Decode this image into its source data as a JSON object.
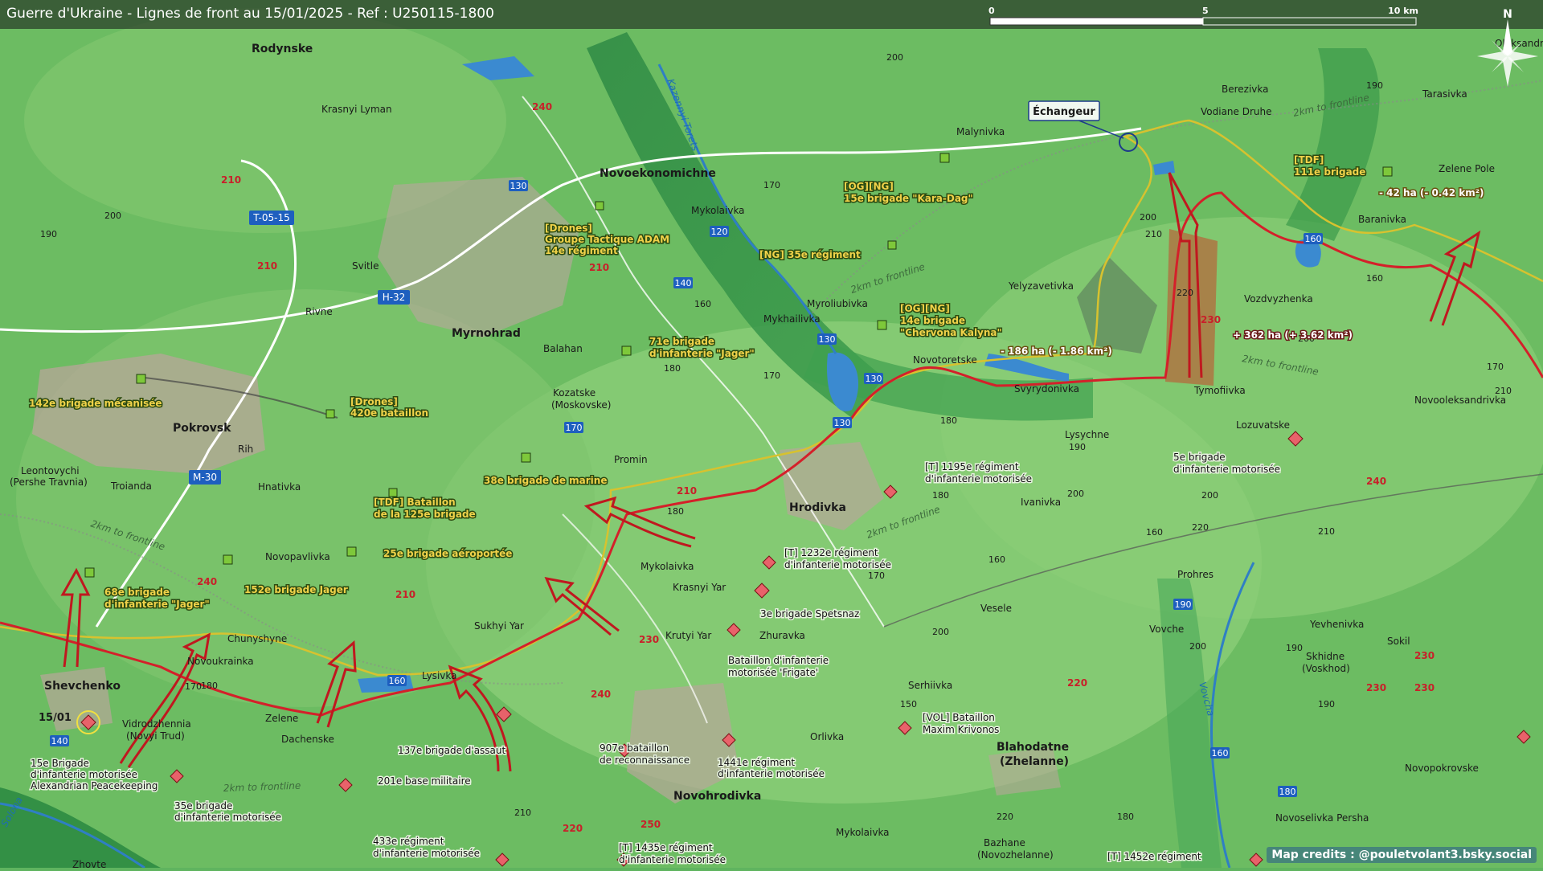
{
  "title": "Guerre d'Ukraine - Lignes de front au 15/01/2025 - Ref : U250115-1800",
  "scale": {
    "ticks": [
      "0",
      "5",
      "10 km"
    ]
  },
  "north": "N",
  "credits": "Map credits : @pouletvolant3.bsky.social",
  "date_marker": "15/01",
  "exchange": "Échangeur",
  "towns": {
    "pokrovsk": "Pokrovsk",
    "myrnohrad": "Myrnohrad",
    "novoekonomichne": "Novoekonomichne",
    "shevchenko": "Shevchenko",
    "hrodivka": "Hrodivka",
    "novohrodivka": "Novohrodivka",
    "blahodatne": "Blahodatne",
    "blahodatne_alt": "(Zhelanne)",
    "rodynske": "Rodynske"
  },
  "villages": {
    "krasnyi_lyman": "Krasnyi Lyman",
    "svitle": "Svitle",
    "rivne": "Rivne",
    "rih": "Rih",
    "leontovychi": "Leontovychi",
    "leontovychi_alt": "(Pershe Travnia)",
    "troianda": "Troianda",
    "hnativka": "Hnativka",
    "novopavlivka": "Novopavlivka",
    "chunyshyne": "Chunyshyne",
    "novoukrainka": "Novoukrainka",
    "vidrodzhennia": "Vidrodzhennia",
    "vidrodzhennia_alt": "(Novyi Trud)",
    "zelene": "Zelene",
    "dachenske": "Dachenske",
    "lysivka": "Lysivka",
    "sukhyi_yar": "Sukhyi Yar",
    "zhovte": "Zhovte",
    "balahan": "Balahan",
    "kozatske": "Kozatske",
    "kozatske_alt": "(Moskovske)",
    "promin": "Promin",
    "mykolaivka_n": "Mykolaivka",
    "mykolaivka_s": "Mykolaivka",
    "mykolaivka_se": "Mykolaivka",
    "krasnyi_yar": "Krasnyi Yar",
    "krutyi_yar": "Krutyi Yar",
    "zhuravka": "Zhuravka",
    "myroliubivka": "Myroliubivka",
    "mykhailivka": "Mykhailivka",
    "novotoretske": "Novotoretske",
    "malynivka": "Malynivka",
    "yelyzavetivka": "Yelyzavetivka",
    "svyrydonivka": "Svyrydonivka",
    "lysychne": "Lysychne",
    "ivanivka": "Ivanivka",
    "vesele": "Vesele",
    "serhiivka": "Serhiivka",
    "orlivka": "Orlivka",
    "bazhane": "Bazhane",
    "bazhane_alt": "(Novozhelanne)",
    "berezivka": "Berezivka",
    "vodiane_druhe": "Vodiane Druhe",
    "tarasivka": "Tarasivka",
    "oleksandropil": "Oleksandropil",
    "zelene_pole": "Zelene Pole",
    "baranivka": "Baranivka",
    "vozdvyzhenka": "Vozdvyzhenka",
    "tymofiivka": "Tymofiivka",
    "novooleksandrivka": "Novooleksandrivka",
    "lozuvatske": "Lozuvatske",
    "prohres": "Prohres",
    "vovche": "Vovche",
    "yevhenivka": "Yevhenivka",
    "sokil": "Sokil",
    "skhidne": "Skhidne",
    "skhidne_alt": "(Voskhod)",
    "novopokrovske": "Novopokrovske",
    "novoselivka_persha": "Novoselivka Persha"
  },
  "rivers": {
    "kazennyi_torets": "Kazennyi Torets",
    "solona": "Solona",
    "vovcha": "Vovcha"
  },
  "roads": {
    "t0515": "T-05-15",
    "h32": "H-32",
    "m30": "M-30"
  },
  "frontline_label": "2km to frontline",
  "elevations": [
    "200",
    "190",
    "210",
    "210",
    "240",
    "170",
    "160",
    "180",
    "200",
    "210",
    "200",
    "220",
    "230",
    "240",
    "210",
    "220",
    "180",
    "170",
    "160",
    "150",
    "190",
    "200",
    "230",
    "210",
    "220",
    "240",
    "230",
    "250",
    "220",
    "210",
    "190",
    "180",
    "200",
    "170",
    "160",
    "180",
    "210",
    "190",
    "200",
    "160",
    "210",
    "220",
    "200",
    "230",
    "180",
    "200",
    "190",
    "170",
    "230",
    "240",
    "210"
  ],
  "route_numbers": [
    "130",
    "120",
    "140",
    "130",
    "130",
    "130",
    "170",
    "160",
    "140",
    "190",
    "160",
    "180"
  ],
  "ua_units": {
    "u142": "142e brigade mécanisée",
    "drones420_1": "[Drones]",
    "drones420_2": "420e bataillon",
    "drones_adam_1": "[Drones]",
    "drones_adam_2": "Groupe Tactique ADAM",
    "drones_adam_3": "14e régiment",
    "u71_1": "71e brigade",
    "u71_2": "d'infanterie \"Jager\"",
    "u38": "38e brigade de marine",
    "tdf125_1": "[TDF] Bataillon",
    "tdf125_2": "de la 125e brigade",
    "u25": "25e brigade aéroportée",
    "u152": "152e brigade Jager",
    "u68_1": "68e brigade",
    "u68_2": "d'infanterie \"Jager\"",
    "ng35": "[NG] 35e régiment",
    "og15_1": "[OG][NG]",
    "og15_2": "15e brigade \"Kara-Dag\"",
    "og14_1": "[OG][NG]",
    "og14_2": "14e brigade",
    "og14_3": "\"Chervona Kalyna\"",
    "tdf111_1": "[TDF]",
    "tdf111_2": "111e brigade"
  },
  "ru_units": {
    "r15_1": "15e Brigade",
    "r15_2": "d'infanterie motorisée",
    "r15_3": "Alexandrian Peacekeeping",
    "r35_1": "35e brigade",
    "r35_2": "d'infanterie motorisée",
    "r201": "201e base militaire",
    "r137": "137e brigade d'assaut",
    "r433_1": "433e régiment",
    "r433_2": "d'infanterie motorisée",
    "r907_1": "907e bataillon",
    "r907_2": "de reconnaissance",
    "r1441_1": "1441e régiment",
    "r1441_2": "d'infanterie motorisée",
    "r1435_1": "[T] 1435e régiment",
    "r1435_2": "d'infanterie motorisée",
    "r1232_1": "[T] 1232e régiment",
    "r1232_2": "d'infanterie motorisée",
    "r3": "3e brigade Spetsnaz",
    "frigate_1": "Bataillon d'infanterie",
    "frigate_2": "motorisée 'Frigate'",
    "r1195_1": "[T] 1195e régiment",
    "r1195_2": "d'infanterie motorisée",
    "vol_1": "[VOL] Bataillon",
    "vol_2": "Maxim Krivonos",
    "r5_1": "5e brigade",
    "r5_2": "d'infanterie motorisée",
    "r1452": "[T] 1452e régiment"
  },
  "area_changes": {
    "loss186": "- 186 ha (- 1.86 km²)",
    "gain362": "+ 362 ha (+ 3.62 km²)",
    "loss42": "- 42 ha (- 0.42 km²)"
  },
  "colors": {
    "front_red": "#d4202a",
    "ua_line": "#d7c22f",
    "captured": "#b07040",
    "water": "#3b8ad0"
  }
}
